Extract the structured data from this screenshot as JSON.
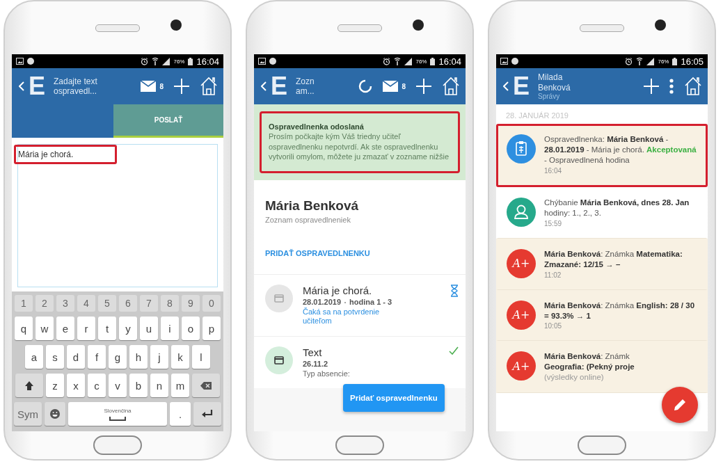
{
  "phones": [
    {
      "kind": "compose",
      "status": {
        "battery": "76%",
        "time": "16:04"
      },
      "app_bar": {
        "logo": "E",
        "title_lines": [
          "Zadajte text",
          "ospravedl..."
        ],
        "actions": [
          {
            "kind": "mail",
            "badge": "8"
          },
          {
            "kind": "add"
          },
          {
            "kind": "home"
          }
        ]
      },
      "tabs": [
        {
          "label": "POSLAŤ",
          "selected": true
        }
      ],
      "message": {
        "value": "Mária je chorá.",
        "highlighted": true
      },
      "keyboard": {
        "key_rows": [
          {
            "keys": [
              {
                "kind": "digit",
                "label": "1"
              },
              {
                "kind": "digit",
                "label": "2"
              },
              {
                "kind": "digit",
                "label": "3"
              },
              {
                "kind": "digit",
                "label": "4"
              },
              {
                "kind": "digit",
                "label": "5"
              },
              {
                "kind": "digit",
                "label": "6"
              },
              {
                "kind": "digit",
                "label": "7"
              },
              {
                "kind": "digit",
                "label": "8"
              },
              {
                "kind": "digit",
                "label": "9"
              },
              {
                "kind": "digit",
                "label": "0"
              }
            ]
          },
          {
            "keys": [
              {
                "kind": "letter",
                "label": "q"
              },
              {
                "kind": "letter",
                "label": "w"
              },
              {
                "kind": "letter",
                "label": "e"
              },
              {
                "kind": "letter",
                "label": "r"
              },
              {
                "kind": "letter",
                "label": "t"
              },
              {
                "kind": "letter",
                "label": "y"
              },
              {
                "kind": "letter",
                "label": "u"
              },
              {
                "kind": "letter",
                "label": "i"
              },
              {
                "kind": "letter",
                "label": "o"
              },
              {
                "kind": "letter",
                "label": "p"
              }
            ]
          },
          {
            "keys": [
              {
                "kind": "letter",
                "label": "a"
              },
              {
                "kind": "letter",
                "label": "s"
              },
              {
                "kind": "letter",
                "label": "d"
              },
              {
                "kind": "letter",
                "label": "f"
              },
              {
                "kind": "letter",
                "label": "g"
              },
              {
                "kind": "letter",
                "label": "h"
              },
              {
                "kind": "letter",
                "label": "j"
              },
              {
                "kind": "letter",
                "label": "k"
              },
              {
                "kind": "letter",
                "label": "l"
              }
            ]
          },
          {
            "keys": [
              {
                "kind": "shift"
              },
              {
                "kind": "letter",
                "label": "z"
              },
              {
                "kind": "letter",
                "label": "x"
              },
              {
                "kind": "letter",
                "label": "c"
              },
              {
                "kind": "letter",
                "label": "v"
              },
              {
                "kind": "letter",
                "label": "b"
              },
              {
                "kind": "letter",
                "label": "n"
              },
              {
                "kind": "letter",
                "label": "m"
              },
              {
                "kind": "backspace"
              }
            ]
          },
          {
            "keys": [
              {
                "kind": "sym",
                "label": "Sym"
              },
              {
                "kind": "emoji"
              },
              {
                "kind": "space",
                "label": "Slovenčina"
              },
              {
                "kind": "period",
                "label": "."
              },
              {
                "kind": "enter"
              }
            ]
          }
        ]
      }
    },
    {
      "kind": "excuses",
      "status": {
        "battery": "76%",
        "time": "16:04"
      },
      "app_bar": {
        "logo": "E",
        "title_lines": [
          "Zozn",
          "am..."
        ],
        "actions": [
          {
            "kind": "spinner"
          },
          {
            "kind": "mail",
            "badge": "8"
          },
          {
            "kind": "add"
          },
          {
            "kind": "home"
          }
        ]
      },
      "notice": {
        "title": "Ospravedlnenka odoslaná",
        "text": "Prosím počkajte kým Váš triedny učiteľ ospravedlnenku nepotvrdí. Ak ste ospravedlnenku vytvorili omylom, môžete ju zmazať v zozname nižšie",
        "highlighted": true
      },
      "student": {
        "name": "Mária Benková",
        "subtitle": "Zoznam ospravedlneniek"
      },
      "add_link": "PRIDAŤ OSPRAVEDLNENKU",
      "excuses": [
        {
          "kind": "pending",
          "title": "Mária je chorá.",
          "date": "28.01.2019",
          "hours": "hodina 1 - 3",
          "status_text": "Čaká sa na potvrdenie učiteľom"
        },
        {
          "kind": "approved",
          "title": "Text",
          "date": "26.11.2",
          "detail": "Typ absencie:"
        }
      ],
      "add_button": "Pridať ospravedlnenku"
    },
    {
      "kind": "feed",
      "status": {
        "battery": "76%",
        "time": "16:05"
      },
      "app_bar": {
        "logo": "E",
        "title_lines": [
          "Milada",
          "Benková"
        ],
        "subtitle": "Správy",
        "actions": [
          {
            "kind": "add"
          },
          {
            "kind": "more"
          },
          {
            "kind": "home"
          }
        ]
      },
      "date_header": "28. JANUÁR 2019",
      "messages": [
        {
          "kind": "document",
          "unread": true,
          "highlighted": true,
          "text": "Ospravedlnenka: **Mária Benková** - **28.01.2019** - Mária je chorá.",
          "status": "Akceptovaná",
          "text_after": "- Ospravedlnená hodina",
          "time": "16:04"
        },
        {
          "kind": "person",
          "unread": false,
          "highlighted": false,
          "text": "Chýbanie **Mária Benková, dnes 28. Jan** hodiny: 1., 2., 3.",
          "time": "15:59"
        },
        {
          "kind": "grade",
          "icon_text": "A+",
          "unread": true,
          "highlighted": false,
          "text": "**Mária Benková**: Známka **Matematika: Zmazané: 12/15 → –**",
          "time": "11:02"
        },
        {
          "kind": "grade",
          "icon_text": "A+",
          "unread": true,
          "highlighted": false,
          "text": "**Mária Benková**: Známka **English: 28 / 30 = 93.3% → 1**",
          "time": "10:05"
        },
        {
          "kind": "grade",
          "icon_text": "A+",
          "unread": true,
          "highlighted": false,
          "text": "**Mária Benková**: Známk **Geografia: (Pekný proje**",
          "note": "(výsledky online)"
        }
      ]
    }
  ]
}
